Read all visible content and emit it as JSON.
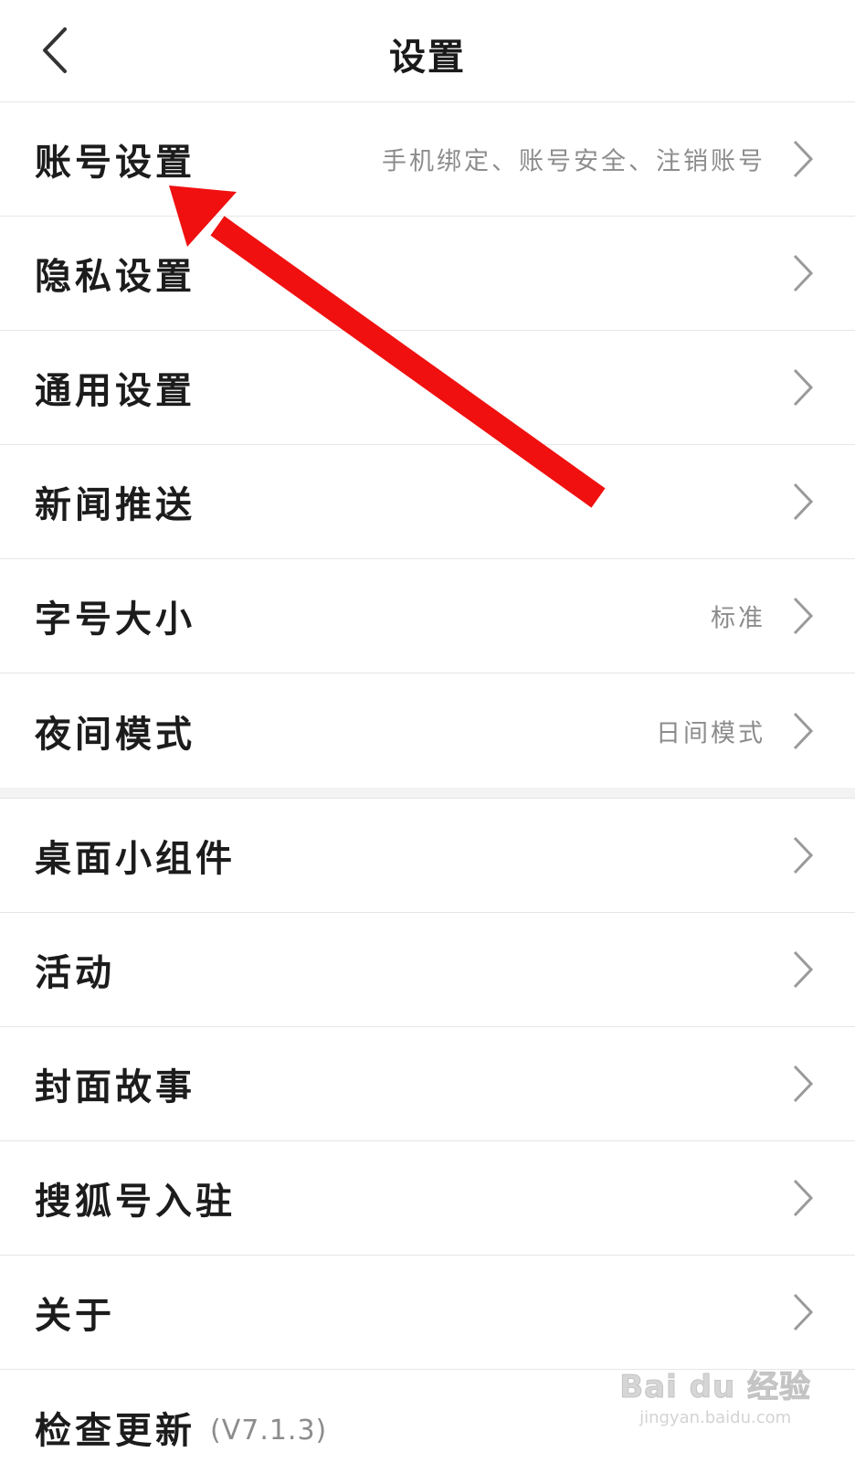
{
  "header": {
    "title": "设置",
    "back_icon": "chevron-left-icon"
  },
  "settings": [
    {
      "label": "账号设置",
      "value": "手机绑定、账号安全、注销账号"
    },
    {
      "label": "隐私设置",
      "value": ""
    },
    {
      "label": "通用设置",
      "value": ""
    },
    {
      "label": "新闻推送",
      "value": ""
    },
    {
      "label": "字号大小",
      "value": "标准"
    },
    {
      "label": "夜间模式",
      "value": "日间模式"
    },
    {
      "label": "桌面小组件",
      "value": ""
    },
    {
      "label": "活动",
      "value": ""
    },
    {
      "label": "封面故事",
      "value": ""
    },
    {
      "label": "搜狐号入驻",
      "value": ""
    },
    {
      "label": "关于",
      "value": ""
    },
    {
      "label": "检查更新",
      "value": ""
    }
  ],
  "version": "(V7.1.3)",
  "chevron_icon": "chevron-right-icon",
  "annotation": {
    "color": "#f01010",
    "target": "账号设置"
  },
  "watermark": {
    "main": "Bai du 经验",
    "sub": "jingyan.baidu.com"
  },
  "colors": {
    "divider": "#e6e6e6",
    "secondary_text": "#8c8c8c",
    "chevron": "#9a9a9a"
  }
}
